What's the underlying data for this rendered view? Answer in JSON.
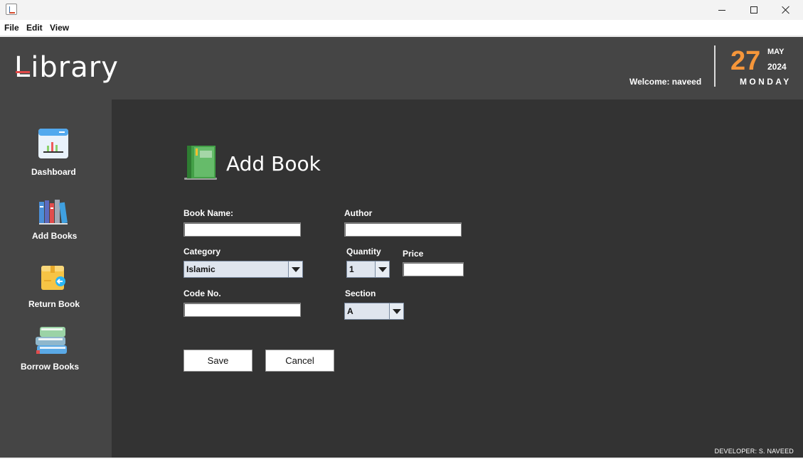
{
  "window": {
    "controls": {
      "minimize": "minimize",
      "maximize": "maximize",
      "close": "close"
    }
  },
  "menu": {
    "items": [
      "File",
      "Edit",
      "View"
    ]
  },
  "header": {
    "logo_text": "Library",
    "welcome": "Welcome: naveed",
    "date": {
      "day": "27",
      "month": "MAY",
      "year": "2024",
      "weekday": "MONDAY"
    }
  },
  "sidebar": {
    "items": [
      {
        "label": "Dashboard",
        "icon": "dashboard-icon"
      },
      {
        "label": "Add Books",
        "icon": "books-icon"
      },
      {
        "label": "Return Book",
        "icon": "return-box-icon"
      },
      {
        "label": "Borrow Books",
        "icon": "book-stack-icon"
      }
    ]
  },
  "form": {
    "title": "Add Book",
    "title_icon": "green-book-icon",
    "book_name": {
      "label": "Book Name:",
      "value": ""
    },
    "author": {
      "label": "Author",
      "value": ""
    },
    "category": {
      "label": "Category",
      "value": "Islamic"
    },
    "quantity": {
      "label": "Quantity",
      "value": "1"
    },
    "price": {
      "label": "Price",
      "value": ""
    },
    "code_no": {
      "label": "Code No.",
      "value": ""
    },
    "section": {
      "label": "Section",
      "value": "A"
    },
    "save_label": "Save",
    "cancel_label": "Cancel"
  },
  "footer": {
    "developer": "DEVELOPER: S. NAVEED"
  },
  "colors": {
    "header_bg": "#454545",
    "main_bg": "#333333",
    "date_accent": "#f5963a"
  }
}
